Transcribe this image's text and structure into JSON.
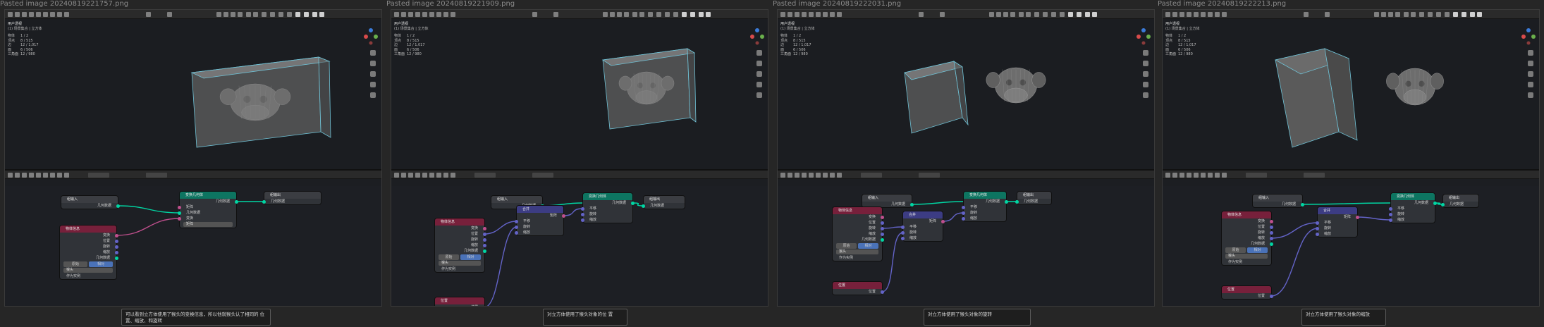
{
  "panels": [
    {
      "filename": "Pasted image 20240819221757.png",
      "caption": "可以看到立方体使用了猴头的变换信息，所以他就猴头认了相同的 位置、缩放、和旋转",
      "stats": {
        "mode": "用户透视",
        "collection": "(1) 场景集合 | 立方体",
        "object_label": "物体",
        "object_value": "1 / 2",
        "vertex_label": "顶点",
        "vertex_value": "8 / 515",
        "edge_label": "边",
        "edge_value": "12 / 1,017",
        "face_label": "面",
        "face_value": "6 / 506",
        "tri_label": "三角面",
        "tri_value": "12 / 980"
      },
      "nodes": [
        {
          "id": "group-input",
          "title": "组输入",
          "rows": [
            "几何数据"
          ]
        },
        {
          "id": "transform",
          "title": "变换几何体",
          "rows": [
            "几何数据",
            "矩阵",
            "几何数据",
            "变换"
          ],
          "field": "矩阵"
        },
        {
          "id": "group-output",
          "title": "组输出",
          "rows": [
            "几何数据"
          ]
        },
        {
          "id": "object-info",
          "title": "物体信息",
          "rows": [
            "变换",
            "位置",
            "旋转",
            "缩放",
            "几何数据"
          ],
          "buttons": [
            "原始",
            "相对"
          ],
          "object": "猴头",
          "as_instance": "作为实例"
        }
      ]
    },
    {
      "filename": "Pasted image 20240819221909.png",
      "caption": "对立方体使用了猴头对象的位 置",
      "stats": {
        "mode": "用户透视",
        "collection": "(1) 场景集合 | 立方体",
        "object_label": "物体",
        "object_value": "1 / 2",
        "vertex_label": "顶点",
        "vertex_value": "8 / 515",
        "edge_label": "边",
        "edge_value": "12 / 1,017",
        "face_label": "面",
        "face_value": "6 / 506",
        "tri_label": "三角面",
        "tri_value": "12 / 980"
      },
      "nodes": [
        {
          "id": "group-input",
          "title": "组输入",
          "rows": [
            "几何数据"
          ]
        },
        {
          "id": "transform",
          "title": "变换几何体",
          "rows": [
            "几何数据",
            "平移",
            "旋转",
            "缩放"
          ]
        },
        {
          "id": "combine",
          "title": "合并",
          "rows": [
            "矩阵",
            "平移",
            "旋转",
            "缩放"
          ]
        },
        {
          "id": "group-output",
          "title": "组输出",
          "rows": [
            "几何数据"
          ]
        },
        {
          "id": "object-info",
          "title": "物体信息",
          "rows": [
            "变换",
            "位置",
            "旋转",
            "缩放",
            "几何数据"
          ],
          "buttons": [
            "原始",
            "相对"
          ],
          "object": "猴头",
          "as_instance": "作为实例"
        },
        {
          "id": "position",
          "title": "位置",
          "rows": [
            "位置"
          ]
        }
      ]
    },
    {
      "filename": "Pasted image 20240819222031.png",
      "caption": "对立方体使用了猴头对象的旋转",
      "stats": {
        "mode": "用户透视",
        "collection": "(1) 场景集合 | 立方体",
        "object_label": "物体",
        "object_value": "1 / 2",
        "vertex_label": "顶点",
        "vertex_value": "8 / 515",
        "edge_label": "边",
        "edge_value": "12 / 1,017",
        "face_label": "面",
        "face_value": "6 / 506",
        "tri_label": "三角面",
        "tri_value": "12 / 980"
      },
      "nodes": [
        {
          "id": "group-input",
          "title": "组输入",
          "rows": [
            "几何数据"
          ]
        },
        {
          "id": "transform",
          "title": "变换几何体",
          "rows": [
            "几何数据",
            "平移",
            "旋转",
            "缩放"
          ]
        },
        {
          "id": "combine",
          "title": "合并",
          "rows": [
            "矩阵",
            "平移",
            "旋转",
            "缩放"
          ]
        },
        {
          "id": "group-output",
          "title": "组输出",
          "rows": [
            "几何数据"
          ]
        },
        {
          "id": "object-info",
          "title": "物体信息",
          "rows": [
            "变换",
            "位置",
            "旋转",
            "缩放",
            "几何数据"
          ],
          "buttons": [
            "原始",
            "相对"
          ],
          "object": "猴头",
          "as_instance": "作为实例"
        },
        {
          "id": "position",
          "title": "位置",
          "rows": [
            "位置"
          ]
        }
      ]
    },
    {
      "filename": "Pasted image 20240819222213.png",
      "caption": "对立方体使用了猴头对象的缩放",
      "stats": {
        "mode": "用户透视",
        "collection": "(1) 场景集合 | 立方体",
        "object_label": "物体",
        "object_value": "1 / 2",
        "vertex_label": "顶点",
        "vertex_value": "8 / 515",
        "edge_label": "边",
        "edge_value": "12 / 1,017",
        "face_label": "面",
        "face_value": "6 / 506",
        "tri_label": "三角面",
        "tri_value": "12 / 980"
      },
      "nodes": [
        {
          "id": "group-input",
          "title": "组输入",
          "rows": [
            "几何数据"
          ]
        },
        {
          "id": "transform",
          "title": "变换几何体",
          "rows": [
            "几何数据",
            "平移",
            "旋转",
            "缩放"
          ]
        },
        {
          "id": "combine",
          "title": "合并",
          "rows": [
            "矩阵",
            "平移",
            "旋转",
            "缩放"
          ]
        },
        {
          "id": "group-output",
          "title": "组输出",
          "rows": [
            "几何数据"
          ]
        },
        {
          "id": "object-info",
          "title": "物体信息",
          "rows": [
            "变换",
            "位置",
            "旋转",
            "缩放",
            "几何数据"
          ],
          "buttons": [
            "原始",
            "相对"
          ],
          "object": "猴头",
          "as_instance": "作为实例"
        },
        {
          "id": "position",
          "title": "位置",
          "rows": [
            "位置"
          ]
        }
      ]
    }
  ],
  "colors": {
    "background": "#262626",
    "geometry_node": "#0d7561",
    "info_node": "#77203b",
    "vector_node": "#3c3c83",
    "geometry_wire": "#00d6a3",
    "matrix_wire": "#c04f8d",
    "vector_wire": "#6363c7",
    "selection_outline": "#6fc2d6"
  },
  "icons": [
    "editor-type-icon",
    "cursor-icon",
    "move-icon",
    "snap-icon",
    "overlay-icon",
    "shading-solid-icon",
    "shading-wire-icon",
    "axis-gizmo-icon",
    "zoom-icon",
    "hand-icon",
    "camera-icon",
    "grid-icon"
  ]
}
